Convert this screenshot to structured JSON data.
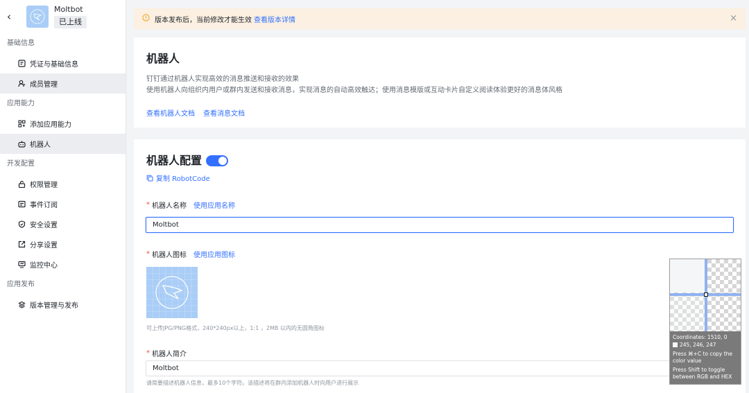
{
  "app": {
    "name": "Moltbot",
    "status": "已上线"
  },
  "sidebar": {
    "sections": [
      {
        "title": "基础信息",
        "items": [
          {
            "label": "凭证与基础信息",
            "icon": "credential-icon"
          },
          {
            "label": "成员管理",
            "icon": "member-icon"
          }
        ]
      },
      {
        "title": "应用能力",
        "items": [
          {
            "label": "添加应用能力",
            "icon": "apps-icon"
          },
          {
            "label": "机器人",
            "icon": "robot-icon"
          }
        ]
      },
      {
        "title": "开发配置",
        "items": [
          {
            "label": "权限管理",
            "icon": "lock-icon"
          },
          {
            "label": "事件订阅",
            "icon": "event-icon"
          },
          {
            "label": "安全设置",
            "icon": "shield-icon"
          },
          {
            "label": "分享设置",
            "icon": "share-icon"
          },
          {
            "label": "监控中心",
            "icon": "monitor-icon"
          }
        ]
      },
      {
        "title": "应用发布",
        "items": [
          {
            "label": "版本管理与发布",
            "icon": "layers-icon"
          }
        ]
      }
    ]
  },
  "notice": {
    "text": "版本发布后，当前修改才能生效",
    "link": "查看版本详情"
  },
  "intro": {
    "title": "机器人",
    "desc1": "钉钉通过机器人实现高效的消息推送和接收的效果",
    "desc2": "使用机器人向组织内用户或群内发送和接收消息，实现消息的自动高效触达；使用消息模版或互动卡片自定义阅读体验更好的消息体风格",
    "link1": "查看机器人文档",
    "link2": "查看消息文档"
  },
  "config": {
    "title": "机器人配置",
    "enabled": true,
    "copy_label": "复制 RobotCode",
    "name_label": "机器人名称",
    "name_link": "使用应用名称",
    "name_value": "Moltbot",
    "icon_label": "机器人图标",
    "icon_link": "使用应用图标",
    "icon_hint": "可上传JPG/PNG格式，240*240px以上，1:1 ，2MB 以内的无圆角图标",
    "intro_label": "机器人简介",
    "intro_value": "Moltbot",
    "intro_hint": "请简要描述机器人信息，最多10个字符。该描述将在群内添加机器人时向用户进行展示"
  },
  "picker": {
    "coords": "Coordinates: 1510, 0",
    "rgb": "245, 246, 247",
    "copy_hint": "Press ⌘+C to copy the color value",
    "toggle_hint": "Press Shift to toggle between RGB and HEX"
  },
  "colors": {
    "accent": "#3370ff",
    "notice_bg": "#fbf0e1",
    "active_bg": "#ebedf0",
    "icon_bg": "#a9cdf6"
  }
}
